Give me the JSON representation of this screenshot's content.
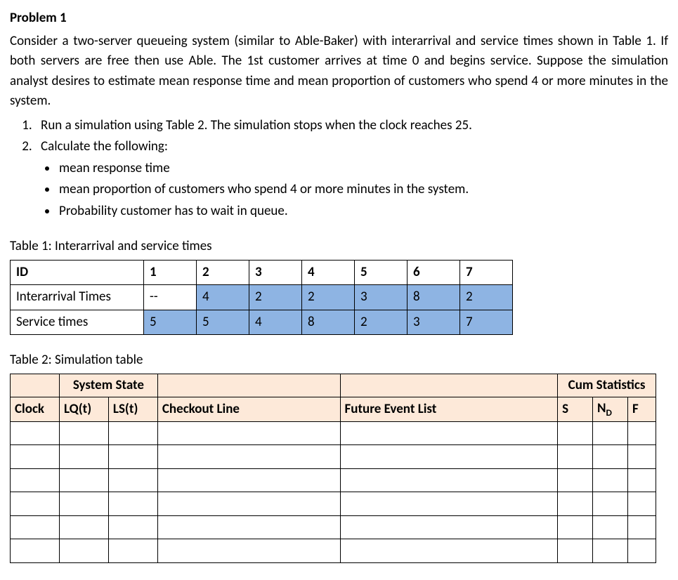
{
  "title": "Problem 1",
  "para1": "Consider a two-server queueing system (similar to Able-Baker) with interarrival and service times shown in Table 1. If both servers are free then use Able. The 1st customer arrives at time 0 and begins service. Suppose the simulation analyst desires to estimate mean response time and mean proportion of customers who spend 4 or more minutes in the system.",
  "list_numbered": [
    "Run a simulation using Table 2. The simulation stops when the clock reaches 25.",
    "Calculate the following:"
  ],
  "list_bullets": [
    "mean response time",
    "mean proportion of customers who spend 4 or more minutes in the system.",
    "Probability customer has to wait in queue."
  ],
  "table1": {
    "caption": "Table 1: Interarrival and service times",
    "rows": [
      {
        "label": "ID",
        "vals": [
          "1",
          "2",
          "3",
          "4",
          "5",
          "6",
          "7"
        ],
        "bold": true
      },
      {
        "label": "Interarrival Times",
        "vals": [
          "--",
          "4",
          "2",
          "2",
          "3",
          "8",
          "2"
        ],
        "bold": false
      },
      {
        "label": "Service times",
        "vals": [
          "5",
          "5",
          "4",
          "8",
          "2",
          "3",
          "7"
        ],
        "bold": false
      }
    ]
  },
  "table2": {
    "caption": "Table 2: Simulation table",
    "header_top": {
      "system_state": "System State",
      "cum_stats": "Cum Statistics"
    },
    "header_bottom": {
      "clock": "Clock",
      "lq": "LQ(t)",
      "ls": "LS(t)",
      "checkout": "Checkout Line",
      "fel": "Future Event List",
      "s": "S",
      "nd_pre": "N",
      "nd_sub": "D",
      "f": "F"
    },
    "empty_rows": 6
  }
}
